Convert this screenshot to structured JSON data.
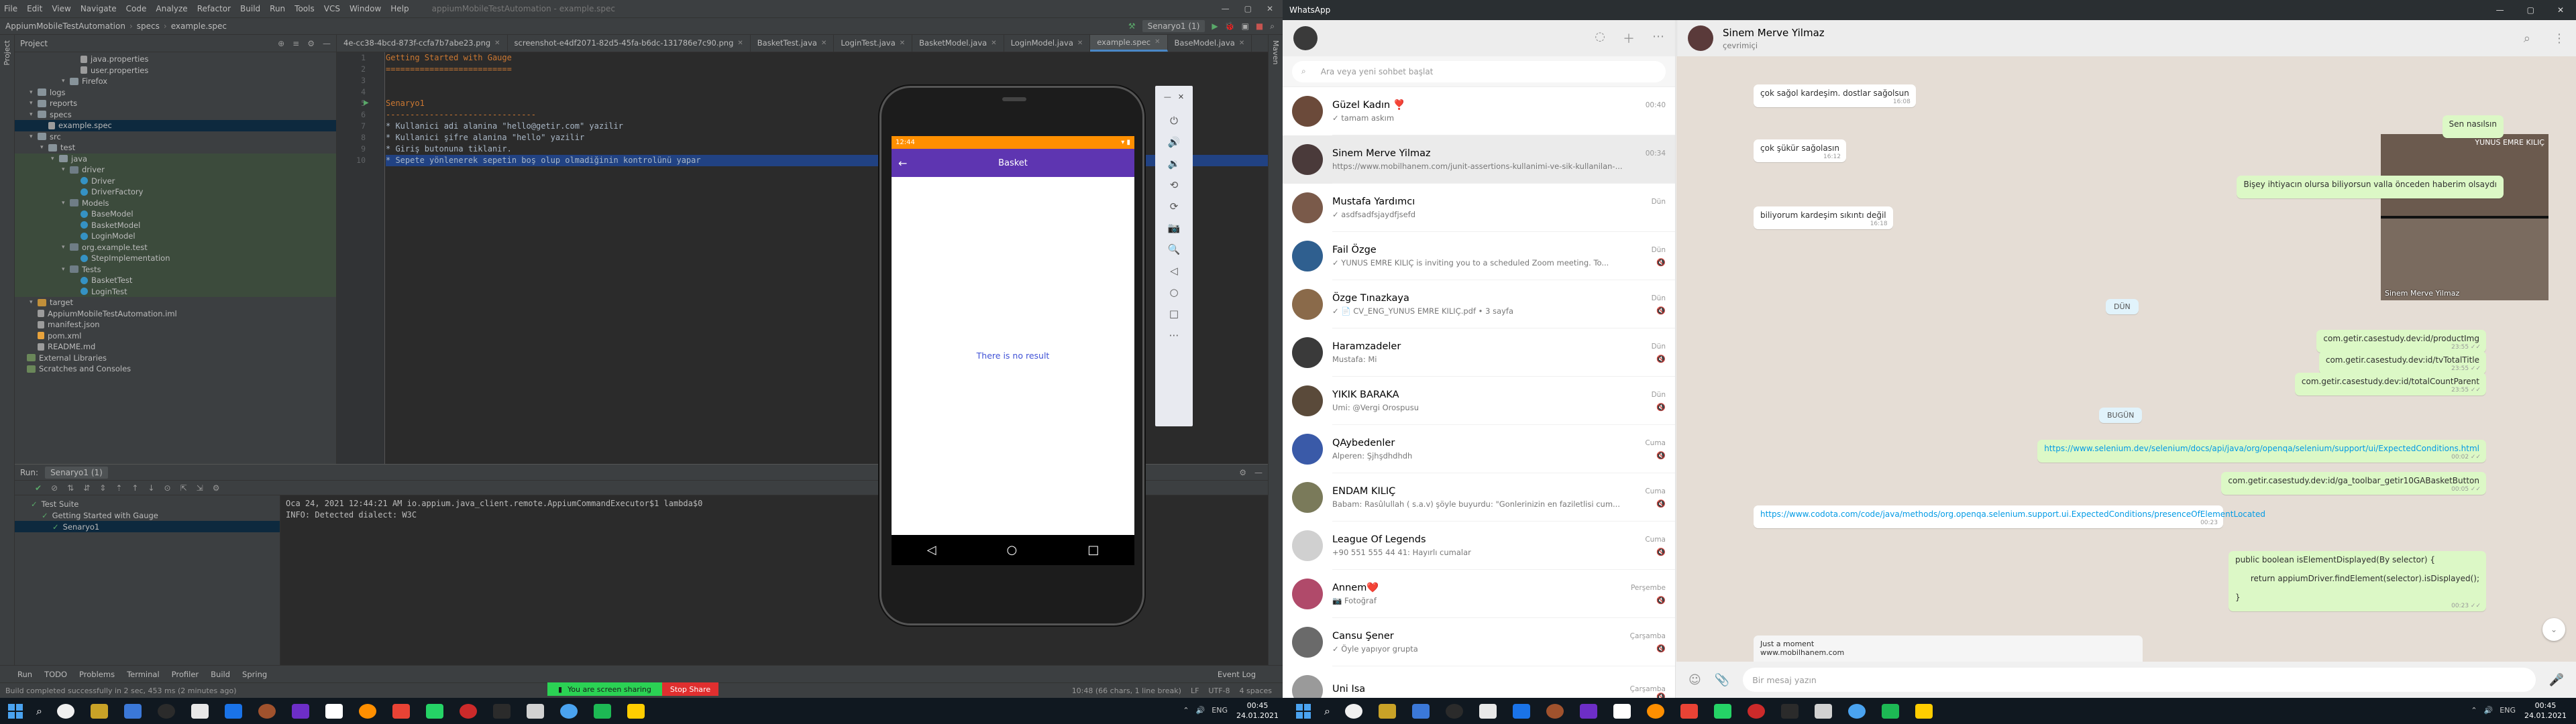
{
  "ide": {
    "menu": [
      "File",
      "Edit",
      "View",
      "Navigate",
      "Code",
      "Analyze",
      "Refactor",
      "Build",
      "Run",
      "Tools",
      "VCS",
      "Window",
      "Help"
    ],
    "window_title": "appiumMobileTestAutomation - example.spec",
    "breadcrumbs": [
      "AppiumMobileTestAutomation",
      "specs",
      "example.spec"
    ],
    "run_config": "Senaryo1 (1)",
    "project_label": "Project",
    "tabs": [
      "4e-cc38-4bcd-873f-ccfa7b7abe23.png",
      "screenshot-e4df2071-82d5-45fa-b6dc-131786e7c90.png",
      "BasketTest.java",
      "LoginTest.java",
      "BasketModel.java",
      "LoginModel.java",
      "example.spec",
      "BaseModel.java"
    ],
    "active_tab_index": 6,
    "tree": [
      {
        "label": "java.properties",
        "depth": 5,
        "kind": "file"
      },
      {
        "label": "user.properties",
        "depth": 5,
        "kind": "file"
      },
      {
        "label": "Firefox",
        "depth": 4,
        "kind": "folder"
      },
      {
        "label": "logs",
        "depth": 1,
        "kind": "folder"
      },
      {
        "label": "reports",
        "depth": 1,
        "kind": "folder"
      },
      {
        "label": "specs",
        "depth": 1,
        "kind": "folder"
      },
      {
        "label": "example.spec",
        "depth": 2,
        "kind": "file",
        "selected": true
      },
      {
        "label": "src",
        "depth": 1,
        "kind": "folder"
      },
      {
        "label": "test",
        "depth": 2,
        "kind": "folder"
      },
      {
        "label": "java",
        "depth": 3,
        "kind": "folder",
        "green": true
      },
      {
        "label": "driver",
        "depth": 4,
        "kind": "pkg",
        "green": true
      },
      {
        "label": "Driver",
        "depth": 5,
        "kind": "cls",
        "green": true
      },
      {
        "label": "DriverFactory",
        "depth": 5,
        "kind": "cls",
        "green": true
      },
      {
        "label": "Models",
        "depth": 4,
        "kind": "pkg",
        "green": true
      },
      {
        "label": "BaseModel",
        "depth": 5,
        "kind": "cls",
        "green": true
      },
      {
        "label": "BasketModel",
        "depth": 5,
        "kind": "cls",
        "green": true
      },
      {
        "label": "LoginModel",
        "depth": 5,
        "kind": "cls",
        "green": true
      },
      {
        "label": "org.example.test",
        "depth": 4,
        "kind": "pkg",
        "green": true
      },
      {
        "label": "StepImplementation",
        "depth": 5,
        "kind": "cls",
        "green": true
      },
      {
        "label": "Tests",
        "depth": 4,
        "kind": "pkg",
        "green": true
      },
      {
        "label": "BasketTest",
        "depth": 5,
        "kind": "cls",
        "green": true
      },
      {
        "label": "LoginTest",
        "depth": 5,
        "kind": "cls",
        "green": true
      },
      {
        "label": "target",
        "depth": 1,
        "kind": "folder",
        "orange": true
      },
      {
        "label": "AppiumMobileTestAutomation.iml",
        "depth": 1,
        "kind": "file"
      },
      {
        "label": "manifest.json",
        "depth": 1,
        "kind": "file"
      },
      {
        "label": "pom.xml",
        "depth": 1,
        "kind": "xml"
      },
      {
        "label": "README.md",
        "depth": 1,
        "kind": "file"
      },
      {
        "label": "External Libraries",
        "depth": 0,
        "kind": "lib"
      },
      {
        "label": "Scratches and Consoles",
        "depth": 0,
        "kind": "lib"
      }
    ],
    "code": [
      {
        "n": "1",
        "text": "Getting Started with Gauge",
        "cls": "h"
      },
      {
        "n": "2",
        "text": "==========================",
        "cls": "h"
      },
      {
        "n": "3",
        "text": "",
        "cls": ""
      },
      {
        "n": "4",
        "text": "",
        "cls": ""
      },
      {
        "n": "5",
        "text": "Senaryo1",
        "cls": "h"
      },
      {
        "n": "6",
        "text": "-------------------------------",
        "cls": "h"
      },
      {
        "n": "7",
        "text": "* Kullanici adi alanina \"hello@getir.com\" yazilir",
        "cls": "step"
      },
      {
        "n": "8",
        "text": "* Kullanici şifre alanina \"hello\" yazilir",
        "cls": "step"
      },
      {
        "n": "9",
        "text": "* Giriş butonuna tiklanir.",
        "cls": "step"
      },
      {
        "n": "10",
        "text": "* Sepete yönlenerek sepetin boş olup olmadiğinin kontrolünü yapar",
        "cls": "cur"
      }
    ],
    "run": {
      "label": "Run:",
      "config": "Senaryo1 (1)",
      "tree": [
        {
          "label": "Test Suite",
          "depth": 0
        },
        {
          "label": "Getting Started with Gauge",
          "depth": 1
        },
        {
          "label": "Senaryo1",
          "depth": 2,
          "selected": true
        }
      ],
      "console": [
        "Oca 24, 2021 12:44:21 AM io.appium.java_client.remote.AppiumCommandExecutor$1 lambda$0",
        "INFO: Detected dialect: W3C"
      ]
    },
    "bottom_tabs": [
      "Run",
      "TODO",
      "Problems",
      "Terminal",
      "Profiler",
      "Build",
      "Spring"
    ],
    "event_log": "Event Log",
    "status_left": "Build completed successfully in 2 sec, 453 ms (2 minutes ago)",
    "status_right": [
      "10:48 (66 chars, 1 line break)",
      "LF",
      "UTF-8",
      "4 spaces"
    ],
    "share_msg": "You are screen sharing",
    "share_stop": "Stop Share"
  },
  "emulator": {
    "status_time": "12:44",
    "title": "Basket",
    "empty_text": "There is no result",
    "side_icons": [
      "power-icon",
      "volume-up-icon",
      "volume-down-icon",
      "rotate-left-icon",
      "rotate-right-icon",
      "camera-icon",
      "zoom-icon",
      "back-icon",
      "home-icon",
      "overview-icon",
      "more-icon"
    ]
  },
  "whatsapp": {
    "title": "WhatsApp",
    "search_placeholder": "Ara veya yeni sohbet başlat",
    "chats": [
      {
        "name": "Güzel Kadın ❣️",
        "time": "00:40",
        "preview": "✓ tamam askım"
      },
      {
        "name": "Sinem Merve Yilmaz",
        "time": "00:34",
        "preview": "https://www.mobilhanem.com/junit-assertions-kullanimi-ve-sik-kullanilan-...",
        "active": true
      },
      {
        "name": "Mustafa Yardımcı",
        "time": "Dün",
        "preview": "✓ asdfsadfsjaydfjsefd"
      },
      {
        "name": "Fail Özge",
        "time": "Dün",
        "preview": "✓ YUNUS EMRE KILIÇ is inviting you to a scheduled Zoom meeting.  To..."
      },
      {
        "name": "Özge Tınazkaya",
        "time": "Dün",
        "preview": "✓ 📄 CV_ENG_YUNUS EMRE KILIÇ.pdf • 3 sayfa"
      },
      {
        "name": "Haramzadeler",
        "time": "Dün",
        "preview": "Mustafa: Mi"
      },
      {
        "name": "YIKIK BARAKA",
        "time": "Dün",
        "preview": "Umi: @Vergi Orospusu"
      },
      {
        "name": "QAybedenler",
        "time": "Cuma",
        "preview": "Alperen: Şjhşdhdhdh"
      },
      {
        "name": "ENDAM KILIÇ",
        "time": "Cuma",
        "preview": "Babam: Rasûlullah ( s.a.v) şöyle buyurdu: \"Gonlerinizin en faziletlisi cum..."
      },
      {
        "name": "League Of Legends",
        "time": "Cuma",
        "preview": "+90 551 555 44 41: Hayırlı cumalar"
      },
      {
        "name": "Annem❤️",
        "time": "Perşembe",
        "preview": "📷 Fotoğraf"
      },
      {
        "name": "Cansu Şener",
        "time": "Çarşamba",
        "preview": "✓ Öyle yapıyor grupta"
      },
      {
        "name": "Uni Isa",
        "time": "Çarşamba",
        "preview": ""
      }
    ],
    "contact": {
      "name": "Sinem Merve Yilmaz",
      "status": "çevrimiçi"
    },
    "messages": [
      {
        "dir": "in",
        "text": "çok sağol kardeşim. dostlar sağolsun",
        "time": "16:08"
      },
      {
        "dir": "out",
        "text": "Sen nasılsın",
        "time": ""
      },
      {
        "dir": "in",
        "text": "çok şükür sağolasın",
        "time": "16:12"
      },
      {
        "dir": "out",
        "text": "Bişey ihtiyacın olursa biliyorsun valla önceden haberim olsaydı",
        "time": ""
      },
      {
        "dir": "in",
        "text": "biliyorum kardeşim sıkıntı değil",
        "time": "16:18"
      },
      {
        "dir": "chip",
        "text": "DÜN"
      },
      {
        "dir": "out",
        "text": "com.getir.casestudy.dev:id/productImg",
        "time": "23:55"
      },
      {
        "dir": "out",
        "text": "com.getir.casestudy.dev:id/tvTotalTitle",
        "time": "23:55"
      },
      {
        "dir": "out",
        "text": "com.getir.casestudy.dev:id/totalCountParent",
        "time": "23:55"
      },
      {
        "dir": "chip",
        "text": "BUGÜN"
      },
      {
        "dir": "out",
        "text": "https://www.selenium.dev/selenium/docs/api/java/org/openqa/selenium/support/ui/ExpectedConditions.html",
        "time": "00:02",
        "link": true
      },
      {
        "dir": "out",
        "text": "com.getir.casestudy.dev:id/ga_toolbar_getir10GABasketButton",
        "time": "00:05"
      },
      {
        "dir": "in",
        "text": "https://www.codota.com/code/java/methods/org.openqa.selenium.support.ui.ExpectedConditions/presenceOfElementLocated",
        "time": "00:23",
        "link": true
      },
      {
        "dir": "out",
        "text": "public boolean isElementDisplayed(By selector) {\n\n      return appiumDriver.findElement(selector).isDisplayed();\n\n}",
        "time": "00:23"
      },
      {
        "dir": "in",
        "text": "Just a moment\nwww.mobilhanem.com",
        "time": ""
      }
    ],
    "video": {
      "tile1": "YUNUS EMRE KILIÇ",
      "tile2": "Sinem Merve Yilmaz"
    },
    "compose_placeholder": "Bir mesaj yazın"
  },
  "taskbar": {
    "left_clock": {
      "time": "00:45",
      "date": "24.01.2021"
    },
    "right_clock": {
      "time": "00:45",
      "date": "24.01.2021"
    }
  }
}
